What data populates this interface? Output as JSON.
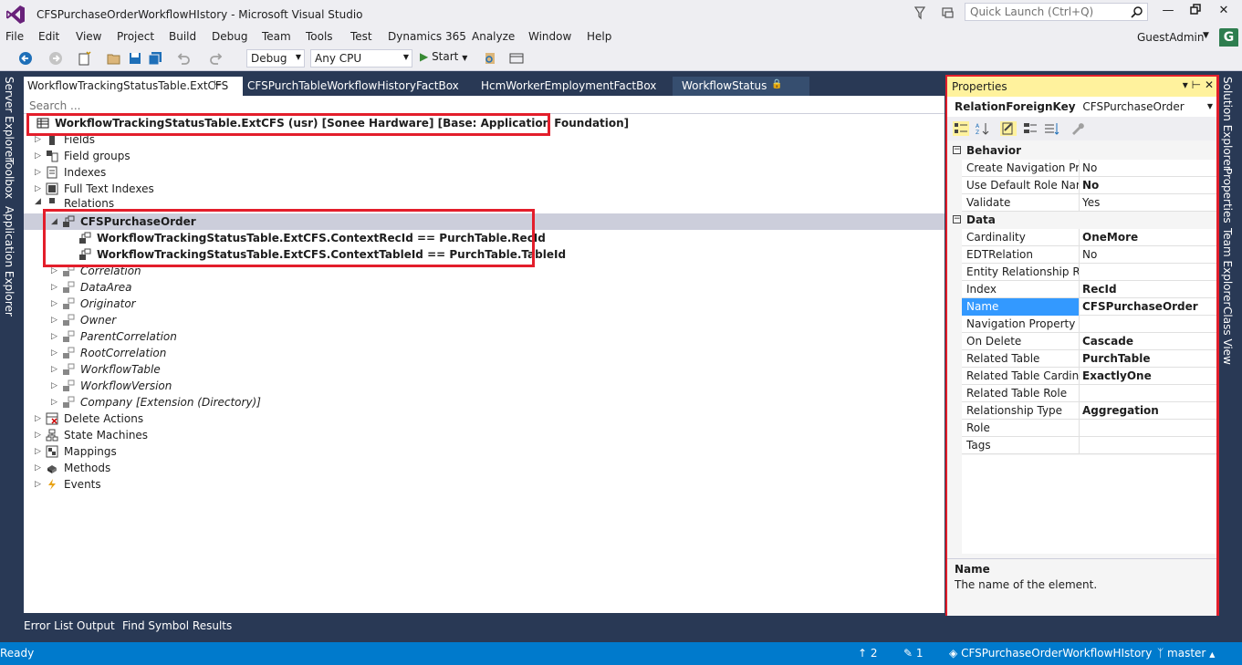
{
  "window": {
    "title": "CFSPurchaseOrderWorkflowHIstory - Microsoft Visual Studio",
    "quick_launch_placeholder": "Quick Launch (Ctrl+Q)",
    "account": "GuestAdmin",
    "avatar_letter": "G"
  },
  "menu": [
    "File",
    "Edit",
    "View",
    "Project",
    "Build",
    "Debug",
    "Team",
    "Tools",
    "Test",
    "Dynamics 365",
    "Analyze",
    "Window",
    "Help"
  ],
  "toolbar": {
    "config": "Debug",
    "platform": "Any CPU",
    "start_label": "Start"
  },
  "left_side_tabs": [
    "Server Explorer",
    "Toolbox",
    "Application Explorer"
  ],
  "right_side_tabs": [
    "Solution Explorer",
    "Properties",
    "Team Explorer",
    "Class View"
  ],
  "doc_tabs": [
    "WorkflowTrackingStatusTable.ExtCFS",
    "CFSPurchTableWorkflowHistoryFactBox",
    "HcmWorkerEmploymentFactBox",
    "WorkflowStatus"
  ],
  "editor": {
    "search_placeholder": "Search ...",
    "root": "WorkflowTrackingStatusTable.ExtCFS (usr) [Sonee Hardware] [Base: Application Foundation]",
    "nodes": {
      "fields": "Fields",
      "field_groups": "Field groups",
      "indexes": "Indexes",
      "full_text_indexes": "Full Text Indexes",
      "relations": "Relations",
      "relation_main": "CFSPurchaseOrder",
      "constraint1": "WorkflowTrackingStatusTable.ExtCFS.ContextRecId == PurchTable.RecId",
      "constraint2": "WorkflowTrackingStatusTable.ExtCFS.ContextTableId == PurchTable.TableId",
      "correlation": "Correlation",
      "data_area": "DataArea",
      "originator": "Originator",
      "owner": "Owner",
      "parent_correlation": "ParentCorrelation",
      "root_correlation": "RootCorrelation",
      "workflow_table": "WorkflowTable",
      "workflow_version": "WorkflowVersion",
      "company": "Company [Extension (Directory)]",
      "delete_actions": "Delete Actions",
      "state_machines": "State Machines",
      "mappings": "Mappings",
      "methods": "Methods",
      "events": "Events"
    }
  },
  "bottom_tabs": [
    "Error List",
    "Output",
    "Find Symbol Results"
  ],
  "status": {
    "ready": "Ready",
    "up_count": "2",
    "edit_count": "1",
    "repo": "CFSPurchaseOrderWorkflowHIstory",
    "branch": "master"
  },
  "properties": {
    "title": "Properties",
    "object_type": "RelationForeignKey",
    "object_name": "CFSPurchaseOrder",
    "categories": {
      "behavior": "Behavior",
      "data": "Data"
    },
    "rows": {
      "create_nav_prop": {
        "name": "Create Navigation Prop",
        "value": "No"
      },
      "use_default_role": {
        "name": "Use Default Role Names",
        "value": "No"
      },
      "validate": {
        "name": "Validate",
        "value": "Yes"
      },
      "cardinality": {
        "name": "Cardinality",
        "value": "OneMore"
      },
      "edt_relation": {
        "name": "EDTRelation",
        "value": "No"
      },
      "entity_rel_role": {
        "name": "Entity Relationship Role",
        "value": ""
      },
      "index": {
        "name": "Index",
        "value": "RecId"
      },
      "name": {
        "name": "Name",
        "value": "CFSPurchaseOrder"
      },
      "nav_prop_method": {
        "name": "Navigation Property Method",
        "value": ""
      },
      "on_delete": {
        "name": "On Delete",
        "value": "Cascade"
      },
      "related_table": {
        "name": "Related Table",
        "value": "PurchTable"
      },
      "related_table_card": {
        "name": "Related Table Cardinality",
        "value": "ExactlyOne"
      },
      "related_table_role": {
        "name": "Related Table Role",
        "value": ""
      },
      "relationship_type": {
        "name": "Relationship Type",
        "value": "Aggregation"
      },
      "role": {
        "name": "Role",
        "value": ""
      },
      "tags": {
        "name": "Tags",
        "value": ""
      }
    },
    "desc_title": "Name",
    "desc_text": "The name of the element."
  },
  "colors": {
    "chrome": "#eeeef2",
    "frame": "#293955",
    "accent": "#007acc",
    "highlight_box": "#e31e2b",
    "props_header": "#fff29d"
  }
}
